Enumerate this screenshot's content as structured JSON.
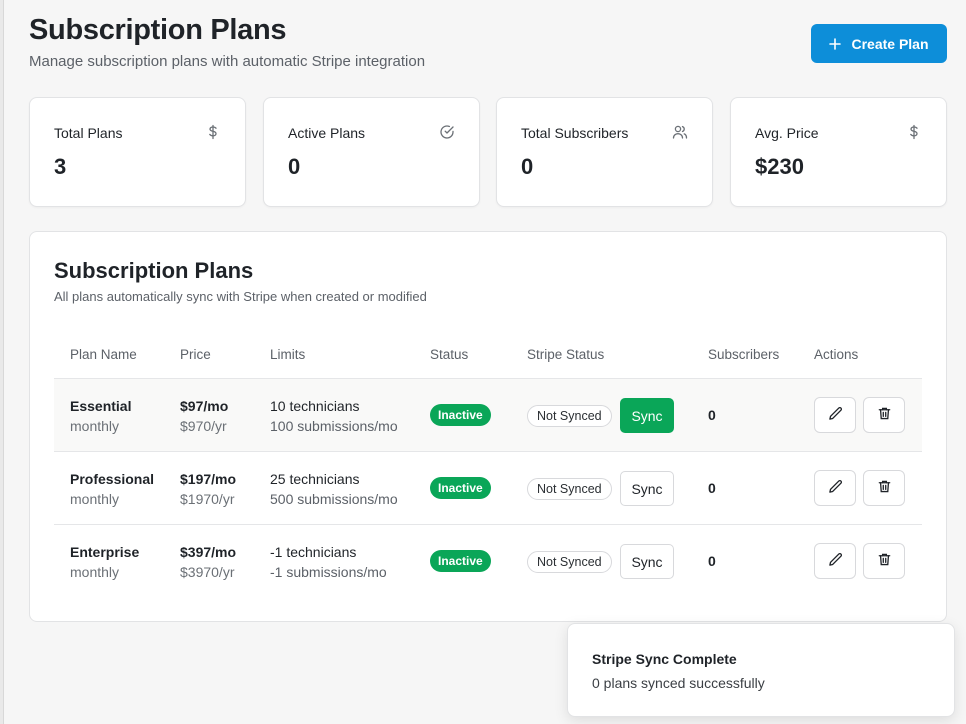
{
  "header": {
    "title": "Subscription Plans",
    "subtitle": "Manage subscription plans with automatic Stripe integration",
    "create_button": {
      "label": "Create Plan",
      "icon": "plus-icon"
    }
  },
  "stats": [
    {
      "label": "Total Plans",
      "value": "3",
      "icon": "dollar-icon"
    },
    {
      "label": "Active Plans",
      "value": "0",
      "icon": "check-circle-icon"
    },
    {
      "label": "Total Subscribers",
      "value": "0",
      "icon": "users-icon"
    },
    {
      "label": "Avg. Price",
      "value": "$230",
      "icon": "dollar-icon"
    }
  ],
  "plans_card": {
    "title": "Subscription Plans",
    "subtitle": "All plans automatically sync with Stripe when created or modified",
    "columns": [
      "Plan Name",
      "Price",
      "Limits",
      "Status",
      "Stripe Status",
      "Subscribers",
      "Actions"
    ],
    "rows": [
      {
        "name": "Essential",
        "interval": "monthly",
        "price": "$97/mo",
        "price_year": "$970/yr",
        "limit_technicians": "10 technicians",
        "limit_submissions": "100 submissions/mo",
        "status": "Inactive",
        "stripe_status": "Not Synced",
        "sync_label": "Sync",
        "subscribers": "0"
      },
      {
        "name": "Professional",
        "interval": "monthly",
        "price": "$197/mo",
        "price_year": "$1970/yr",
        "limit_technicians": "25 technicians",
        "limit_submissions": "500 submissions/mo",
        "status": "Inactive",
        "stripe_status": "Not Synced",
        "sync_label": "Sync",
        "subscribers": "0"
      },
      {
        "name": "Enterprise",
        "interval": "monthly",
        "price": "$397/mo",
        "price_year": "$3970/yr",
        "limit_technicians": "-1 technicians",
        "limit_submissions": "-1 submissions/mo",
        "status": "Inactive",
        "stripe_status": "Not Synced",
        "sync_label": "Sync",
        "subscribers": "0"
      }
    ],
    "action_icons": [
      "pencil-icon",
      "trash-icon"
    ]
  },
  "toast": {
    "title": "Stripe Sync Complete",
    "description": "0 plans synced successfully"
  },
  "colors": {
    "primary": "#0d8ed9",
    "success": "#0aa658",
    "background": "#f6f6f6",
    "text": "#1f2328",
    "muted": "#5c6168"
  }
}
